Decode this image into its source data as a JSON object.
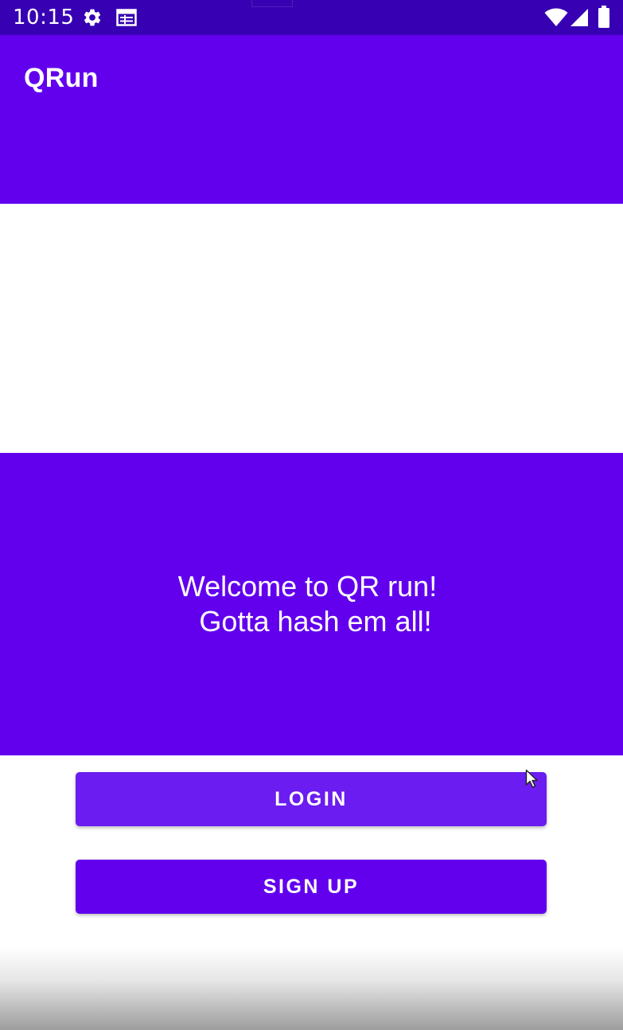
{
  "status_bar": {
    "time": "10:15",
    "left_icons": [
      "gear-icon",
      "calendar-icon"
    ],
    "right_icons": [
      "wifi-icon",
      "signal-icon",
      "battery-icon"
    ],
    "background": "#3700b3"
  },
  "app_bar": {
    "title": "QRun",
    "background": "#6200ee"
  },
  "welcome": {
    "line1": "Welcome to QR run!",
    "line2": "Gotta hash em all!",
    "background": "#6200ee"
  },
  "buttons": {
    "login_label": "LOGIN",
    "signup_label": "SIGN UP"
  },
  "colors": {
    "primary": "#6200ee",
    "primary_dark": "#3700b3",
    "on_primary": "#ffffff"
  }
}
